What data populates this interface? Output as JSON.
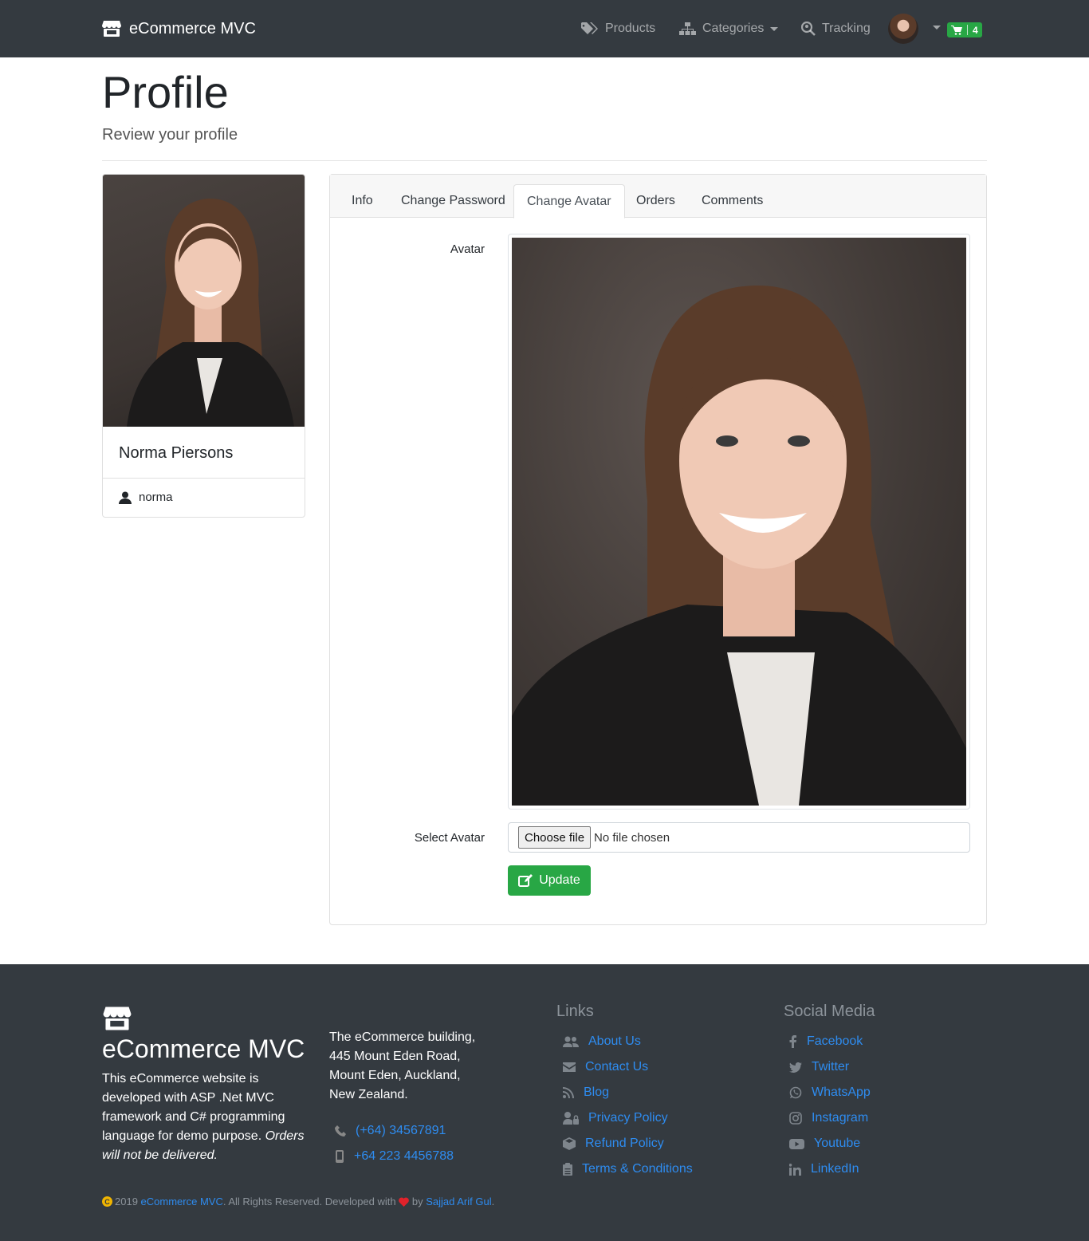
{
  "navbar": {
    "brand": "eCommerce MVC",
    "products": "Products",
    "categories": "Categories",
    "tracking": "Tracking",
    "cart_count": "4"
  },
  "header": {
    "title": "Profile",
    "subtitle": "Review your profile"
  },
  "profile_card": {
    "name": "Norma Piersons",
    "username": "norma"
  },
  "tabs": [
    {
      "label": "Info"
    },
    {
      "label": "Change Password"
    },
    {
      "label": "Change Avatar"
    },
    {
      "label": "Orders"
    },
    {
      "label": "Comments"
    }
  ],
  "active_tab": "Change Avatar",
  "form": {
    "avatar_label": "Avatar",
    "select_label": "Select Avatar",
    "choose_file": "Choose file",
    "no_file": "No file chosen",
    "update": "Update"
  },
  "footer": {
    "brand": "eCommerce MVC",
    "description": "This eCommerce website is developed with ASP .Net MVC framework and C# programming language for demo purpose.",
    "description_italic": "Orders will not be delivered.",
    "address": [
      "The eCommerce building,",
      "445 Mount Eden Road,",
      "Mount Eden, Auckland,",
      "New Zealand."
    ],
    "phone": "(+64) 34567891",
    "mobile": "+64 223 4456788",
    "links_heading": "Links",
    "links": [
      "About Us",
      "Contact Us",
      "Blog",
      "Privacy Policy",
      "Refund Policy",
      "Terms & Conditions"
    ],
    "social_heading": "Social Media",
    "social": [
      "Facebook",
      "Twitter",
      "WhatsApp",
      "Instagram",
      "Youtube",
      "LinkedIn"
    ],
    "copyright_year": "2019",
    "copyright_brand": "eCommerce MVC",
    "copyright_text": ". All Rights Reserved. Developed with",
    "copyright_by": "by",
    "developer": "Sajjad Arif Gul",
    "copyright_end": "."
  },
  "colors": {
    "navbar_bg": "#343a40",
    "success": "#28a745",
    "link": "#2e8cf0"
  }
}
